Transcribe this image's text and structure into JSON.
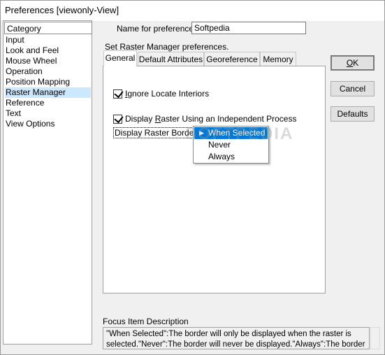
{
  "window": {
    "title": "Preferences [viewonly-View]"
  },
  "category": {
    "header": "Category",
    "items": [
      "Input",
      "Look and Feel",
      "Mouse Wheel",
      "Operation",
      "Position Mapping",
      "Raster Manager",
      "Reference",
      "Text",
      "View Options"
    ],
    "selected_index": 5
  },
  "name_field": {
    "label": "Name for preferences",
    "value": "Softpedia"
  },
  "section_title": "Set Raster Manager preferences.",
  "tabs": [
    "General",
    "Default Attributes",
    "Georeference",
    "Memory"
  ],
  "general": {
    "ignore_locate": {
      "label_first": "I",
      "label_rest": "gnore Locate Interiors",
      "checked": true
    },
    "display_raster": {
      "label_pre": "Display ",
      "label_u": "R",
      "label_post": "aster Using an Independent Process",
      "checked": true
    },
    "border": {
      "label": "Display Raster Border:",
      "options": [
        "When Selected",
        "Never",
        "Always"
      ],
      "selected": "When Selected"
    }
  },
  "buttons": {
    "ok": "OK",
    "ok_underline": "O",
    "ok_rest": "K",
    "cancel": "Cancel",
    "defaults": "Defaults"
  },
  "focus": {
    "label": "Focus Item Description",
    "text": "\"When Selected\":The border will only be displayed when the raster is selected.\"Never\":The border will never be displayed.\"Always\":The border"
  },
  "watermark": "SOFTPEDIA"
}
